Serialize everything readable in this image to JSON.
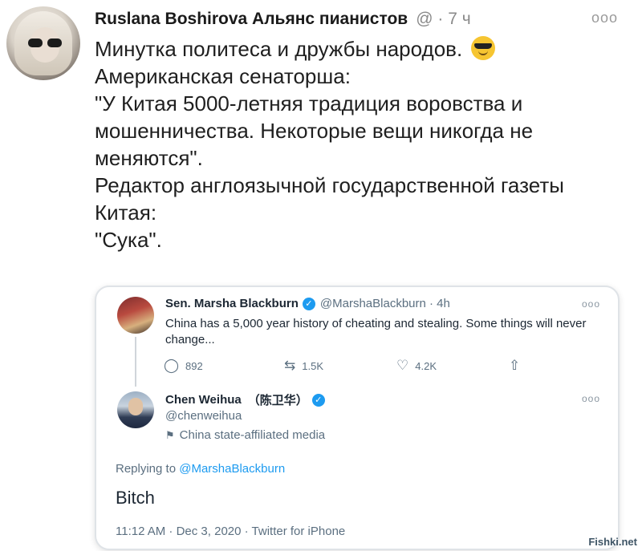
{
  "post": {
    "author": "Ruslana Boshirova Альянс пианистов",
    "meta": "@ · 7 ч",
    "more": "ooo",
    "lines": [
      "Минутка политеса и дружбы народов.",
      "Американская сенаторша:",
      "\"У Китая 5000-летняя традиция воровства и",
      "мошенничества. Некоторые вещи никогда не",
      "меняются\".",
      "Редактор англоязычной государственной газеты",
      "Китая:",
      "\"Сука\"."
    ],
    "emoji": "smiling-face-with-sunglasses-icon"
  },
  "embed": {
    "tweet1": {
      "name": "Sen. Marsha Blackburn",
      "handle": "@MarshaBlackburn · 4h",
      "text": "China has a 5,000 year history of cheating and stealing. Some things will never change...",
      "more": "ooo",
      "replies": "892",
      "retweets": "1.5K",
      "likes": "4.2K"
    },
    "tweet2": {
      "name": "Chen Weihua",
      "name_cn": "（陈卫华）",
      "handle": "@chenweihua",
      "affiliation": "China state-affiliated media",
      "more": "ooo",
      "replying_prefix": "Replying to ",
      "replying_to": "@MarshaBlackburn",
      "text": "Bitch",
      "timestamp": "11:12 AM · Dec 3, 2020 · Twitter for iPhone"
    }
  },
  "watermark": "Fishki.net",
  "colors": {
    "link": "#1d9bf0",
    "muted": "#5b6f80",
    "verified": "#1d9bf0"
  }
}
